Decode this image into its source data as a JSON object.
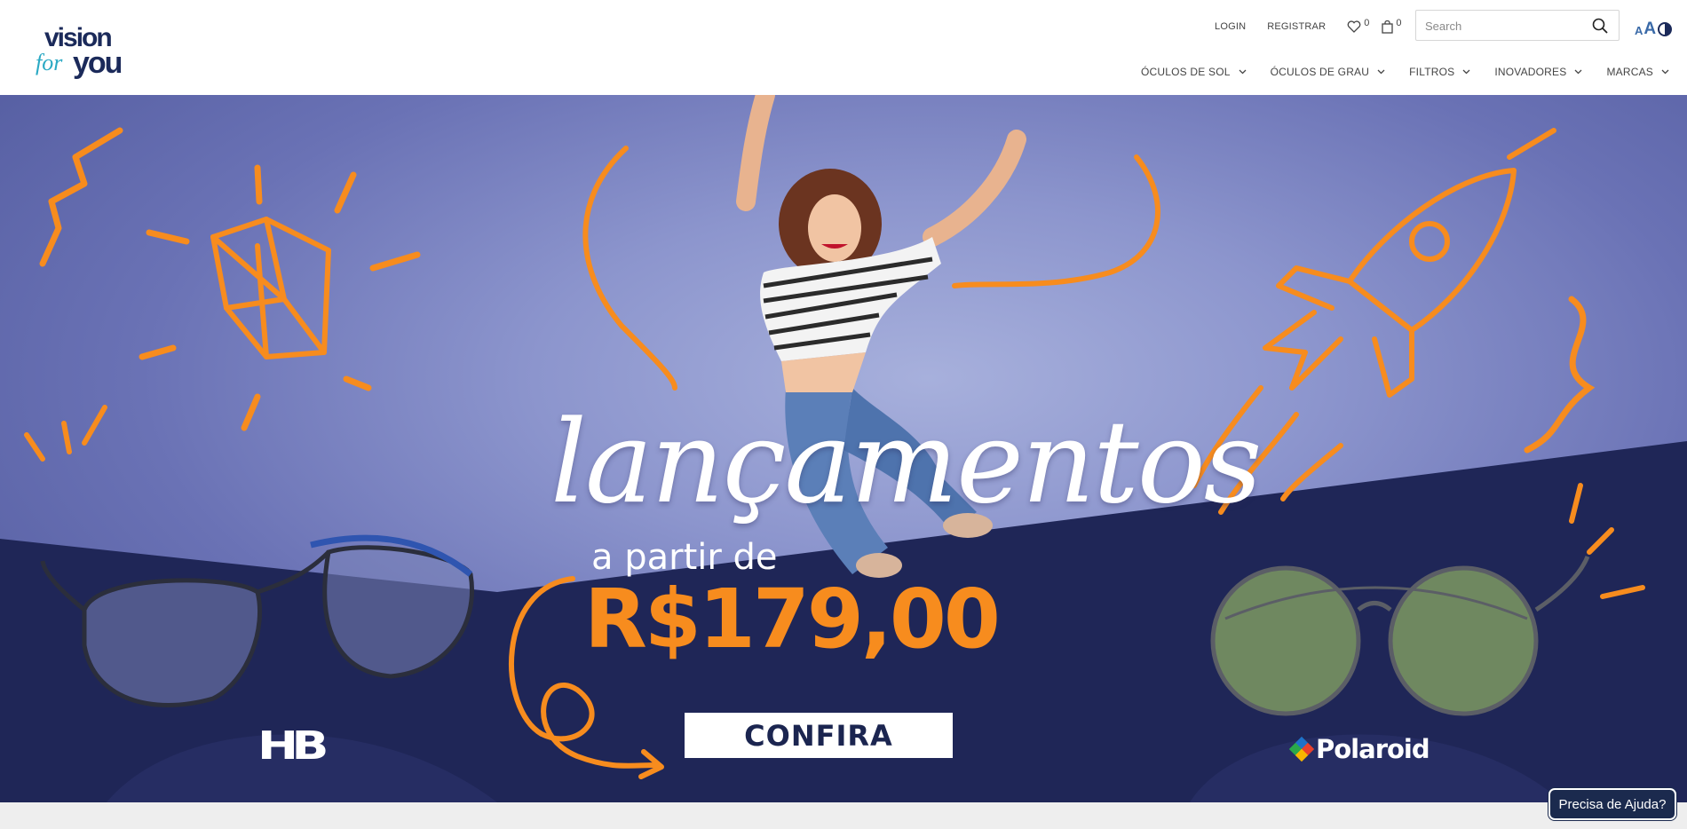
{
  "header": {
    "logo_text": {
      "line1": "vision",
      "line2": "for",
      "line3": "you"
    },
    "top_links": {
      "login": "LOGIN",
      "register": "REGISTRAR"
    },
    "wishlist_count": "0",
    "cart_count": "0",
    "search": {
      "placeholder": "Search"
    },
    "a11y": {
      "small": "A",
      "big": "A"
    },
    "nav": [
      {
        "label": "ÓCULOS DE SOL"
      },
      {
        "label": "ÓCULOS DE GRAU"
      },
      {
        "label": "FILTROS"
      },
      {
        "label": "INOVADORES"
      },
      {
        "label": "MARCAS"
      }
    ]
  },
  "hero": {
    "title": "lançamentos",
    "from_text": "a partir de",
    "price": "R$179,00",
    "cta_label": "CONFIRA",
    "brand_left": "HB",
    "brand_right": "Polaroid",
    "colors": {
      "background": "#7c85c5",
      "navy": "#1f2657",
      "orange": "#f78c1e"
    }
  },
  "help": {
    "label": "Precisa de Ajuda?"
  }
}
